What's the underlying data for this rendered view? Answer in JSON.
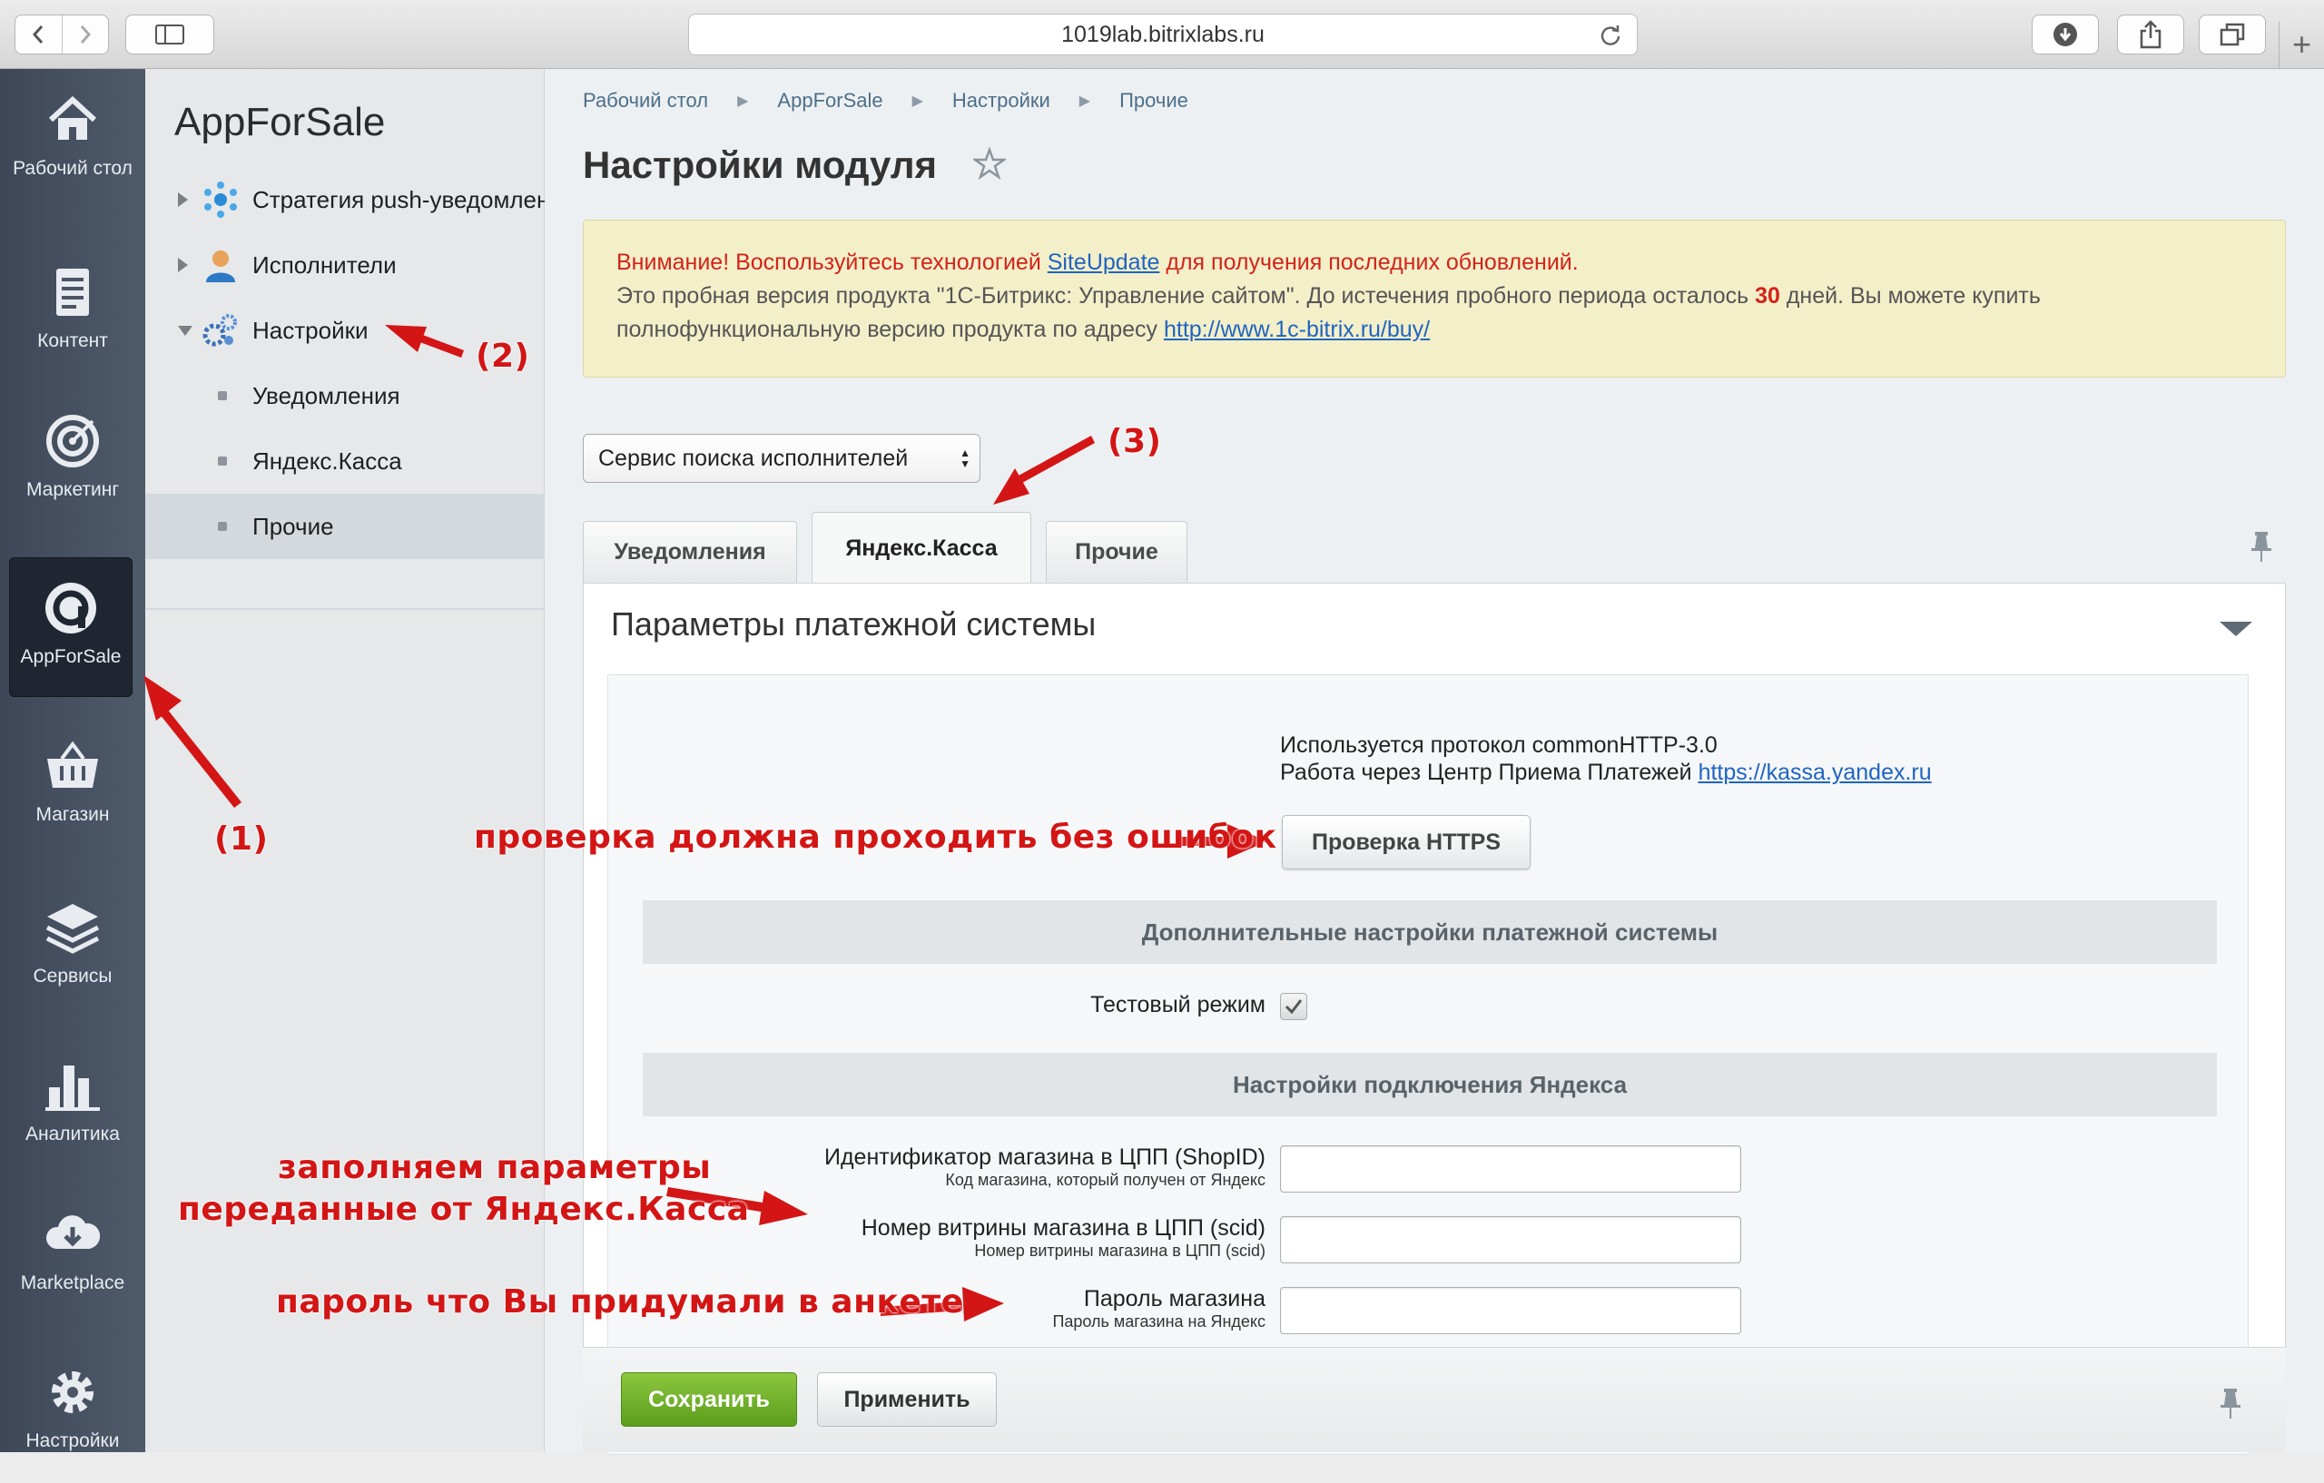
{
  "browser": {
    "url": "1019lab.bitrixlabs.ru"
  },
  "appbar": {
    "items": [
      {
        "label": "Рабочий стол",
        "icon": "home-icon"
      },
      {
        "label": "Контент",
        "icon": "document-icon"
      },
      {
        "label": "Маркетинг",
        "icon": "target-icon"
      },
      {
        "label": "AppForSale",
        "icon": "appforsale-icon"
      },
      {
        "label": "Магазин",
        "icon": "basket-icon"
      },
      {
        "label": "Сервисы",
        "icon": "layers-icon"
      },
      {
        "label": "Аналитика",
        "icon": "bar-chart-icon"
      },
      {
        "label": "Marketplace",
        "icon": "cloud-download-icon"
      },
      {
        "label": "Настройки",
        "icon": "gear-icon"
      }
    ],
    "active": "AppForSale"
  },
  "menu": {
    "title": "AppForSale",
    "items": [
      {
        "label": "Стратегия push-уведомлений"
      },
      {
        "label": "Исполнители"
      },
      {
        "label": "Настройки"
      },
      {
        "label": "Уведомления"
      },
      {
        "label": "Яндекс.Касса"
      },
      {
        "label": "Прочие"
      }
    ]
  },
  "breadcrumbs": [
    "Рабочий стол",
    "AppForSale",
    "Настройки",
    "Прочие"
  ],
  "page_title": "Настройки модуля",
  "notice": {
    "warning_prefix": "Внимание! Воспользуйтесь технологией ",
    "warning_link": "SiteUpdate",
    "warning_suffix": " для получения последних обновлений.",
    "trial_text_1": "Это пробная версия продукта \"1С-Битрикс: Управление сайтом\". До истечения пробного периода осталось ",
    "trial_days": "30",
    "trial_text_2": " дней. Вы можете купить полнофункциональную версию продукта по адресу ",
    "buy_link": "http://www.1c-bitrix.ru/buy/"
  },
  "module_select": {
    "value": "Сервис поиска исполнителей"
  },
  "tabs": [
    {
      "label": "Уведомления"
    },
    {
      "label": "Яндекс.Касса"
    },
    {
      "label": "Прочие"
    }
  ],
  "active_tab": "Яндекс.Касса",
  "panel": {
    "title": "Параметры платежной системы",
    "protocol_line": "Используется протокол commonHTTP-3.0",
    "center_prefix": "Работа через Центр Приема Платежей ",
    "center_link": "https://kassa.yandex.ru",
    "https_button": "Проверка HTTPS",
    "section_extra": "Дополнительные настройки платежной системы",
    "test_mode_label": "Тестовый режим",
    "test_mode_checked": true,
    "section_yandex": "Настройки подключения Яндекса",
    "fields": [
      {
        "label": "Идентификатор магазина в ЦПП (ShopID)",
        "hint": "Код магазина, который получен от Яндекс",
        "value": ""
      },
      {
        "label": "Номер витрины магазина в ЦПП (scid)",
        "hint": "Номер витрины магазина в ЦПП (scid)",
        "value": ""
      },
      {
        "label": "Пароль магазина",
        "hint": "Пароль магазина на Яндекс",
        "value": ""
      }
    ]
  },
  "footer": {
    "save": "Сохранить",
    "apply": "Применить"
  },
  "annotations": {
    "a1": "(1)",
    "a2": "(2)",
    "a3": "(3)",
    "https_note": "проверка должна проходить без ошибок",
    "fill_note_1": "заполняем параметры",
    "fill_note_2": "переданные от Яндекс.Касса",
    "password_note": "пароль что Вы придумали в анкете"
  },
  "colors": {
    "annotation": "#d31515",
    "save_button": "#6fb02a",
    "link": "#1f64c2",
    "appbar": "#465062"
  }
}
